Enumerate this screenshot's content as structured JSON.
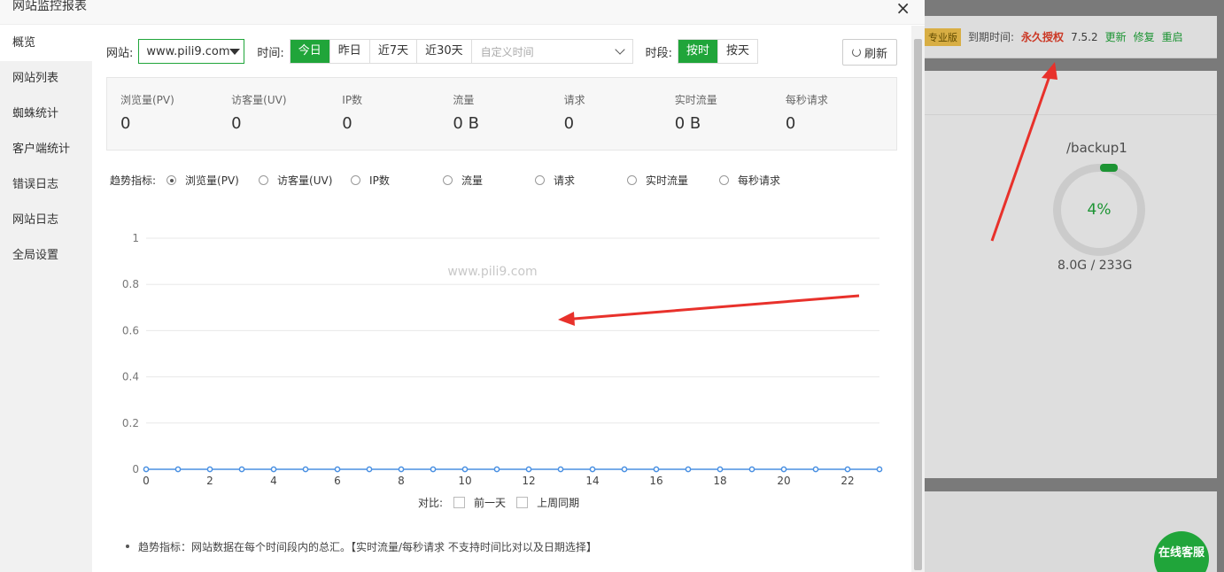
{
  "background": {
    "badge": "专业版",
    "expire_label": "到期时间:",
    "expire_value": "永久授权",
    "version": "7.5.2",
    "links": [
      "更新",
      "修复",
      "重启"
    ],
    "disk": {
      "name": "/backup1",
      "percent": "4%",
      "usage": "8.0G / 233G",
      "fill": 0.04
    },
    "online_service": "在线客服"
  },
  "modal": {
    "title": "网站监控报表",
    "close": "×",
    "sidebar": [
      "概览",
      "网站列表",
      "蜘蛛统计",
      "客户端统计",
      "错误日志",
      "网站日志",
      "全局设置"
    ],
    "toolbar": {
      "site_label": "网站:",
      "site_value": "www.pili9.com",
      "time_label": "时间:",
      "time_options": [
        "今日",
        "昨日",
        "近7天",
        "近30天"
      ],
      "date_placeholder": "自定义时间",
      "period_label": "时段:",
      "period_options": [
        "按时",
        "按天"
      ],
      "refresh": "刷新"
    },
    "stats": [
      {
        "label": "浏览量(PV)",
        "value": "0"
      },
      {
        "label": "访客量(UV)",
        "value": "0"
      },
      {
        "label": "IP数",
        "value": "0"
      },
      {
        "label": "流量",
        "value": "0 B"
      },
      {
        "label": "请求",
        "value": "0"
      },
      {
        "label": "实时流量",
        "value": "0 B"
      },
      {
        "label": "每秒请求",
        "value": "0"
      }
    ],
    "trend": {
      "label": "趋势指标:",
      "options": [
        "浏览量(PV)",
        "访客量(UV)",
        "IP数",
        "流量",
        "请求",
        "实时流量",
        "每秒请求"
      ]
    },
    "compare": {
      "label": "对比:",
      "options": [
        "前一天",
        "上周同期"
      ]
    },
    "note": "趋势指标：网站数据在每个时间段内的总汇。【实时流量/每秒请求 不支持时间比对以及日期选择】",
    "watermark": "www.pili9.com"
  },
  "chart_data": {
    "type": "line",
    "x": [
      0,
      1,
      2,
      3,
      4,
      5,
      6,
      7,
      8,
      9,
      10,
      11,
      12,
      13,
      14,
      15,
      16,
      17,
      18,
      19,
      20,
      21,
      22,
      23
    ],
    "series": [
      {
        "name": "浏览量(PV)",
        "values": [
          0,
          0,
          0,
          0,
          0,
          0,
          0,
          0,
          0,
          0,
          0,
          0,
          0,
          0,
          0,
          0,
          0,
          0,
          0,
          0,
          0,
          0,
          0,
          0
        ]
      }
    ],
    "xticks": [
      "0",
      "2",
      "4",
      "6",
      "8",
      "10",
      "12",
      "14",
      "16",
      "18",
      "20",
      "22"
    ],
    "yticks": [
      "0",
      "0.2",
      "0.4",
      "0.6",
      "0.8",
      "1"
    ],
    "ylim": [
      0,
      1
    ],
    "xlim": [
      0,
      23
    ],
    "grid": true,
    "legend": "bottom",
    "color": "#4a90e2"
  }
}
